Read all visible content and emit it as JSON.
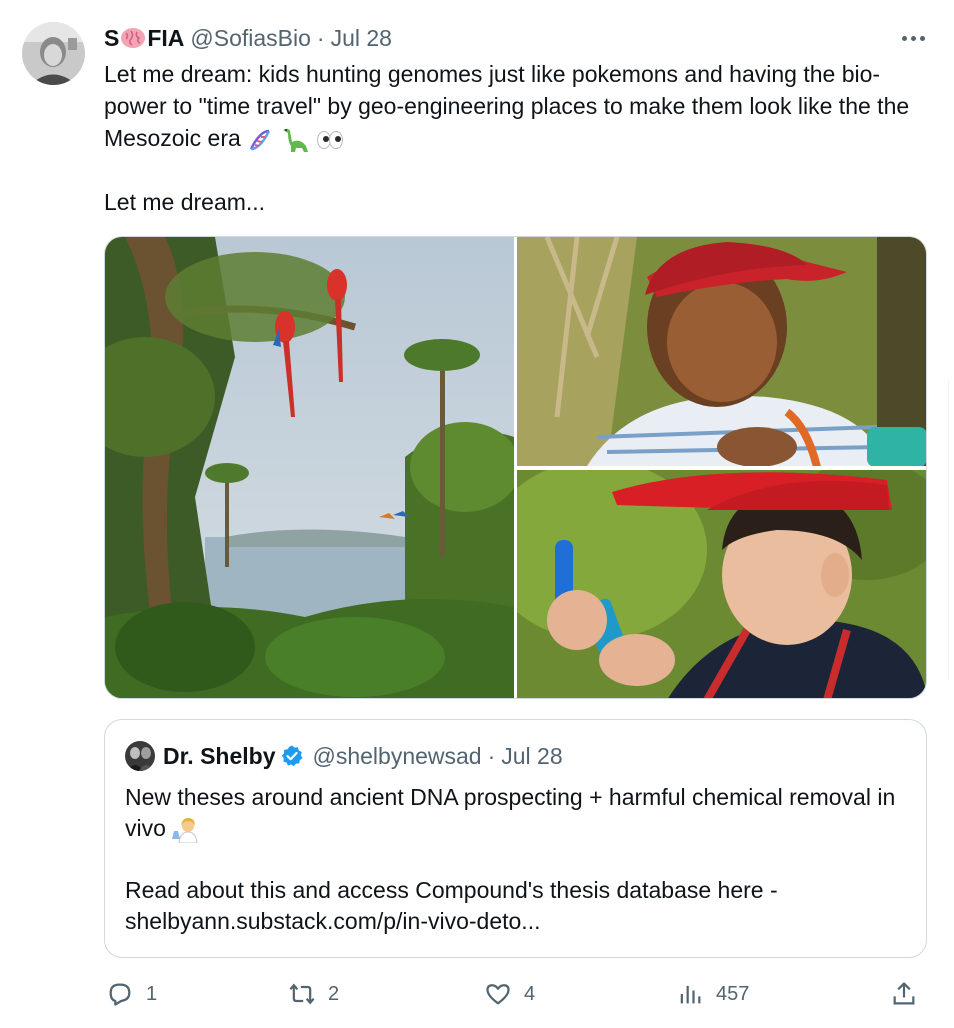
{
  "tweet": {
    "display_name_prefix": "S",
    "display_name_suffix": "FIA",
    "handle": "@SofiasBio",
    "separator": "·",
    "date": "Jul 28",
    "text_line1": "Let me dream: kids hunting genomes just like pokemons and having the bio-power to \"time travel\" by geo-engineering places to make them look like the the Mesozoic era",
    "text_line2": "Let me dream..."
  },
  "quote": {
    "display_name": "Dr. Shelby",
    "handle": "@shelbynewsad",
    "separator": "·",
    "date": "Jul 28",
    "text_line1": "New theses around ancient DNA prospecting + harmful chemical removal in vivo",
    "text_line2": "Read about this and access Compound's thesis database here - shelbyann.substack.com/p/in-vivo-deto..."
  },
  "actions": {
    "replies": "1",
    "retweets": "2",
    "likes": "4",
    "views": "457"
  },
  "icons": {
    "more": "more-horizontal-icon",
    "reply": "reply-icon",
    "retweet": "retweet-icon",
    "like": "heart-icon",
    "views": "views-icon",
    "share": "share-icon",
    "verified": "verified-badge-icon",
    "emoji_name": "brain-emoji",
    "emoji_line": [
      "dna-emoji",
      "sauropod-emoji",
      "eyes-emoji"
    ],
    "emoji_quote": "woman-scientist-emoji"
  },
  "colors": {
    "text": "#0f1419",
    "secondary": "#536471",
    "border": "#cfd9de",
    "verified": "#1d9bf0"
  }
}
